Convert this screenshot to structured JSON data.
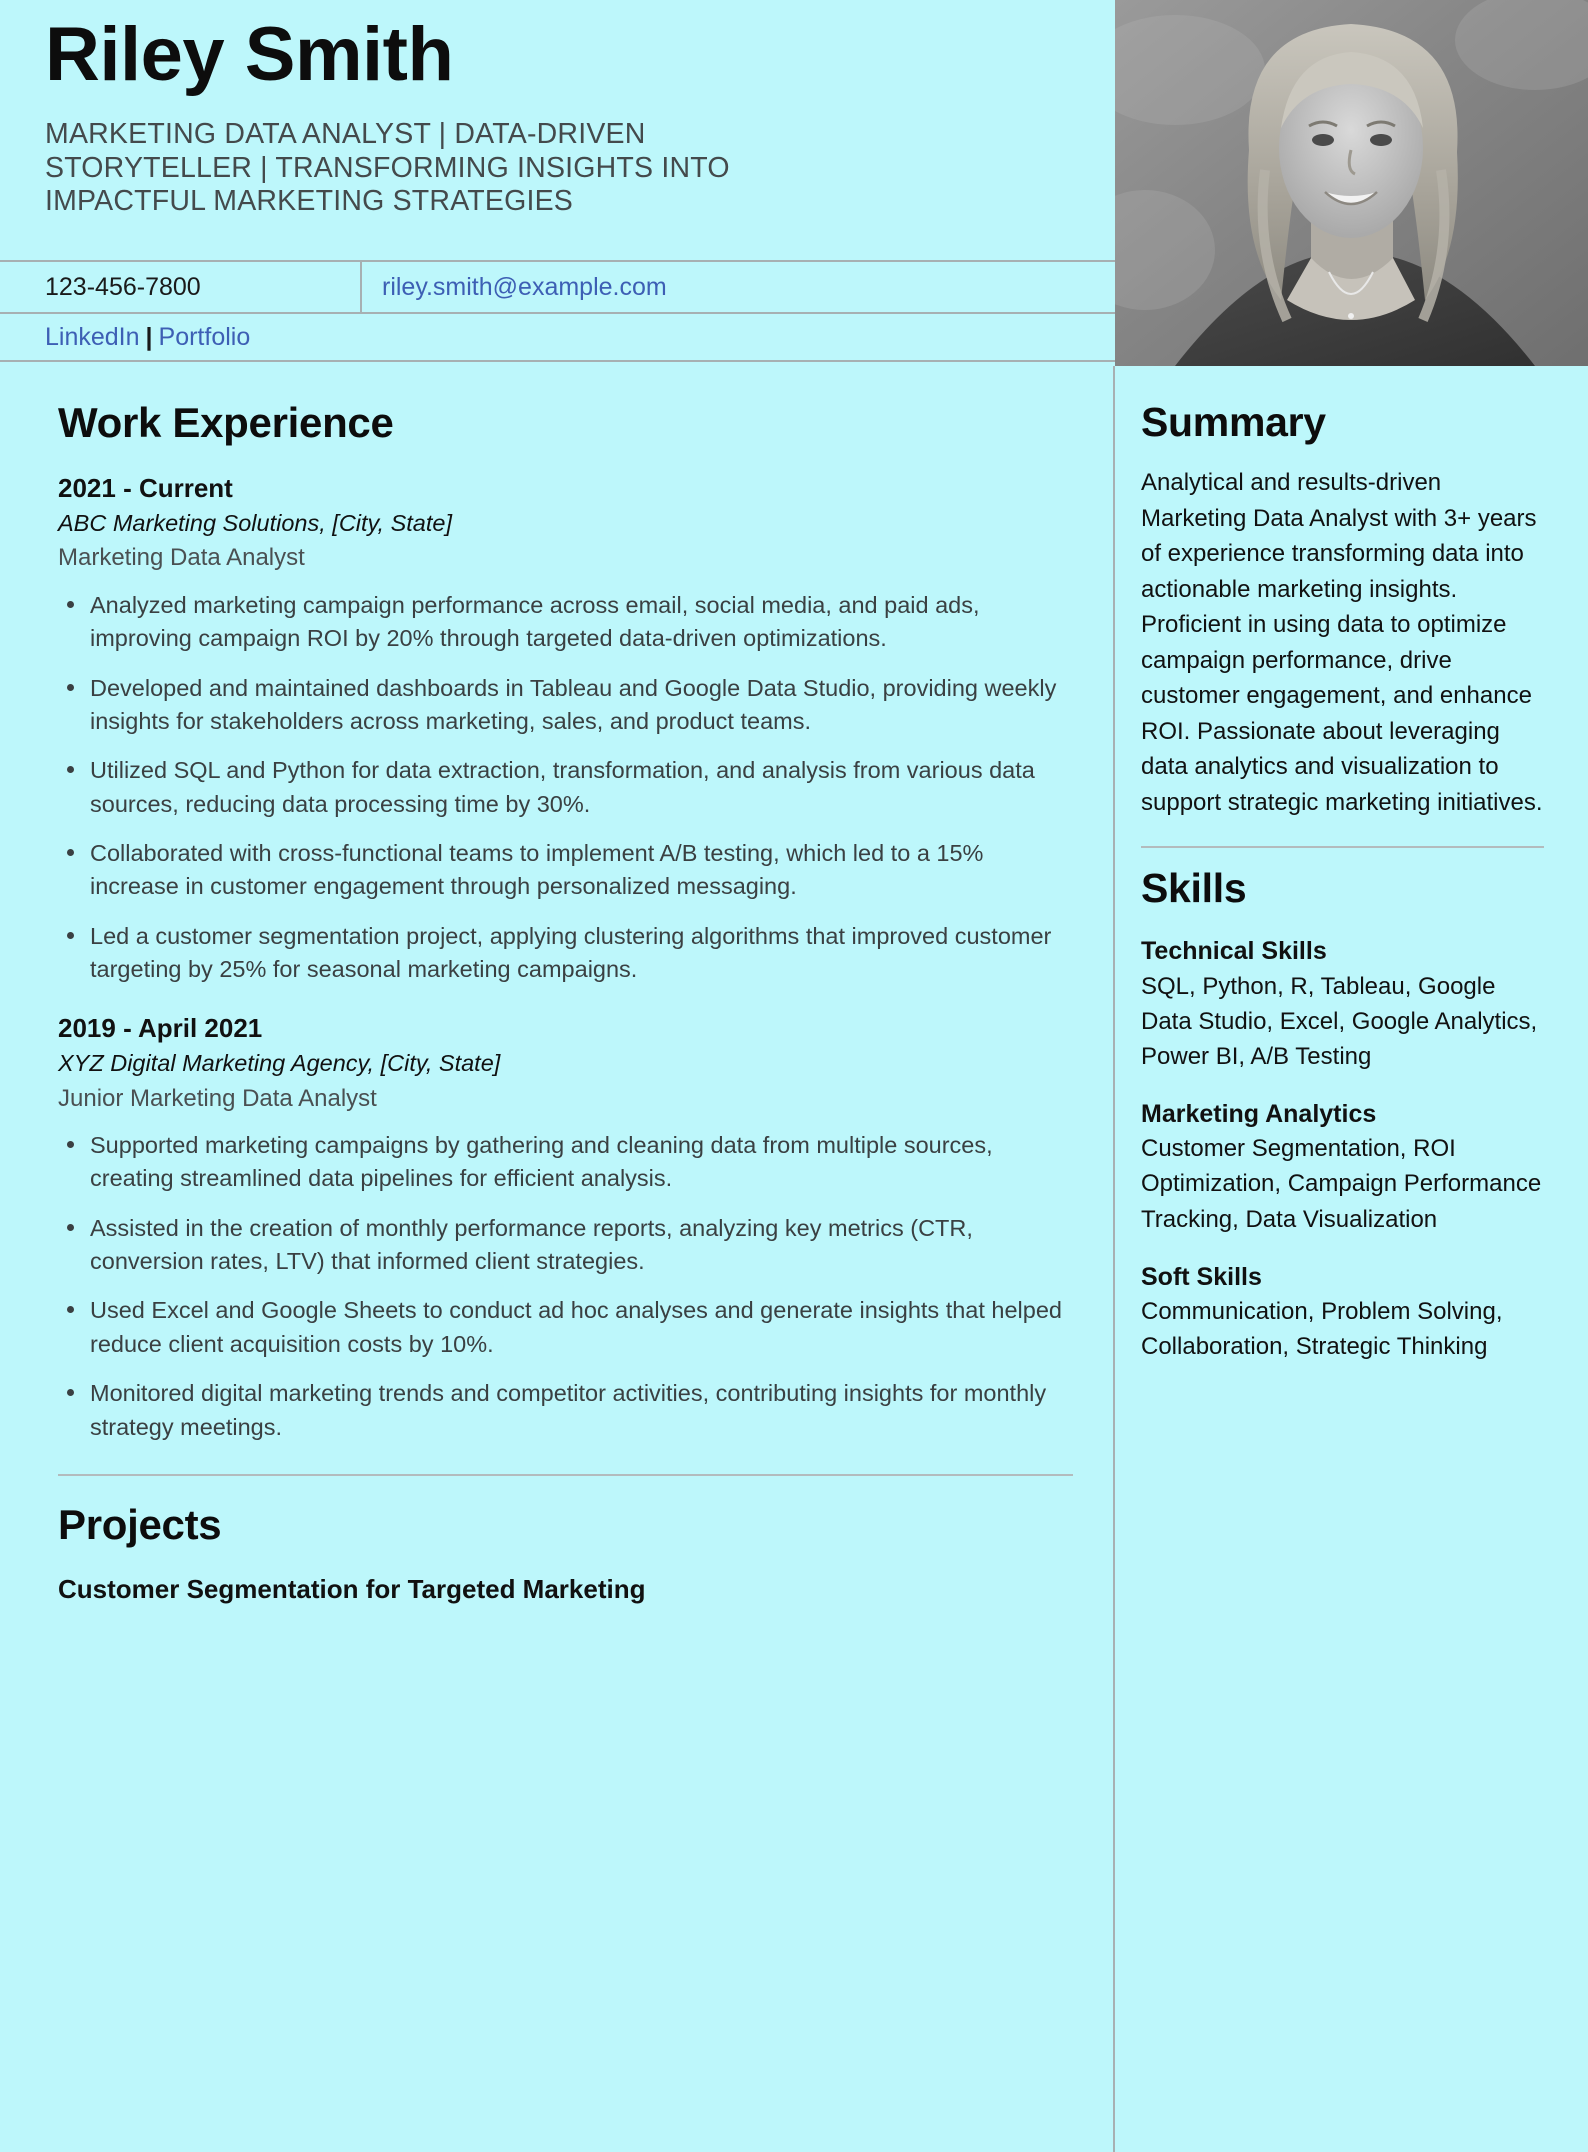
{
  "colors": {
    "background": "#bdf7fb",
    "rule": "#a7b0b2",
    "link": "#3d5fb4",
    "text": "#111111",
    "muted": "#4a5052"
  },
  "header": {
    "name": "Riley Smith",
    "headline": "MARKETING DATA ANALYST | DATA-DRIVEN STORYTELLER | TRANSFORMING INSIGHTS INTO IMPACTFUL MARKETING STRATEGIES",
    "phone": "123-456-7800",
    "email": "riley.smith@example.com",
    "links": {
      "linkedin": "LinkedIn",
      "separator": "|",
      "portfolio": "Portfolio"
    },
    "photo_alt": "headshot-photo"
  },
  "main": {
    "work_experience": {
      "title": "Work Experience",
      "jobs": [
        {
          "dates": "2021 - Current",
          "company": "ABC Marketing Solutions, [City, State]",
          "role": "Marketing Data Analyst",
          "bullets": [
            "Analyzed marketing campaign performance across email, social media, and paid ads, improving campaign ROI by 20% through targeted data-driven optimizations.",
            "Developed and maintained dashboards in Tableau and Google Data Studio, providing weekly insights for stakeholders across marketing, sales, and product teams.",
            "Utilized SQL and Python for data extraction, transformation, and analysis from various data sources, reducing data processing time by 30%.",
            "Collaborated with cross-functional teams to implement A/B testing, which led to a 15% increase in customer engagement through personalized messaging.",
            "Led a customer segmentation project, applying clustering algorithms that improved customer targeting by 25% for seasonal marketing campaigns."
          ]
        },
        {
          "dates": "2019 - April 2021",
          "company": "XYZ Digital Marketing Agency, [City, State]",
          "role": "Junior Marketing Data Analyst",
          "bullets": [
            "Supported marketing campaigns by gathering and cleaning data from multiple sources, creating streamlined data pipelines for efficient analysis.",
            "Assisted in the creation of monthly performance reports, analyzing key metrics (CTR, conversion rates, LTV) that informed client strategies.",
            "Used Excel and Google Sheets to conduct ad hoc analyses and generate insights that helped reduce client acquisition costs by 10%.",
            "Monitored digital marketing trends and competitor activities, contributing insights for monthly strategy meetings."
          ]
        }
      ]
    },
    "projects": {
      "title": "Projects",
      "items": [
        {
          "name": "Customer Segmentation for Targeted Marketing"
        }
      ]
    }
  },
  "sidebar": {
    "summary": {
      "title": "Summary",
      "text": "Analytical and results-driven Marketing Data Analyst with 3+ years of experience transforming data into actionable marketing insights. Proficient in using data to optimize campaign performance, drive customer engagement, and enhance ROI. Passionate about leveraging data analytics and visualization to support strategic marketing initiatives."
    },
    "skills": {
      "title": "Skills",
      "groups": [
        {
          "heading": "Technical Skills",
          "items": "SQL, Python, R, Tableau, Google Data Studio, Excel, Google Analytics, Power BI, A/B Testing"
        },
        {
          "heading": "Marketing Analytics",
          "items": "Customer Segmentation, ROI Optimization, Campaign Performance Tracking, Data Visualization"
        },
        {
          "heading": "Soft Skills",
          "items": "Communication, Problem Solving, Collaboration, Strategic Thinking"
        }
      ]
    }
  }
}
